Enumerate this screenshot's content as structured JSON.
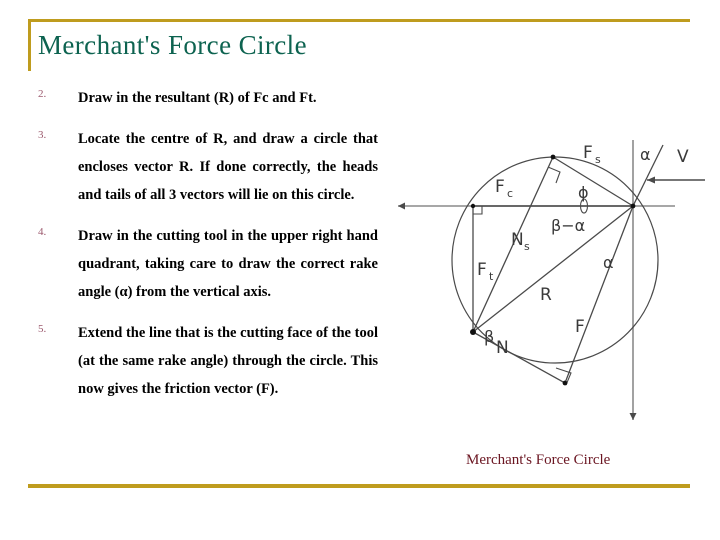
{
  "slide": {
    "title": "Merchant's Force Circle",
    "caption": "Merchant's Force Circle",
    "accent_gold": "#bf9c1e",
    "title_color": "#0d6350",
    "caption_color": "#6b1622",
    "number_color": "#9c5a6e"
  },
  "bullets": [
    {
      "number": "2.",
      "text": "Draw in the resultant (R) of Fc and Ft."
    },
    {
      "number": "3.",
      "text": "Locate the centre of R, and draw a circle that encloses vector R. If done correctly, the heads and tails of all 3 vectors will lie on this circle."
    },
    {
      "number": "4.",
      "text": "Draw in the cutting tool in the upper right hand quadrant, taking care to draw the correct rake angle (α) from the vertical axis."
    },
    {
      "number": "5.",
      "text": "Extend the line that is the cutting face of the tool (at the same rake angle) through the circle. This now gives the friction vector (F)."
    }
  ],
  "diagram": {
    "name": "merchants-force-circle",
    "labels": {
      "fs": "F",
      "fs_sub": "s",
      "fc": "F",
      "fc_sub": "c",
      "ft": "F",
      "ft_sub": "t",
      "ns": "N",
      "ns_sub": "s",
      "r": "R",
      "n": "N",
      "f": "F",
      "v": "V",
      "phi": "ϕ",
      "alpha_top": "α",
      "alpha_mid": "α",
      "beta": "β",
      "beta_minus_alpha": "β−α"
    },
    "line_color": "#3a3a3a",
    "axis_color": "#8a8a8a"
  }
}
